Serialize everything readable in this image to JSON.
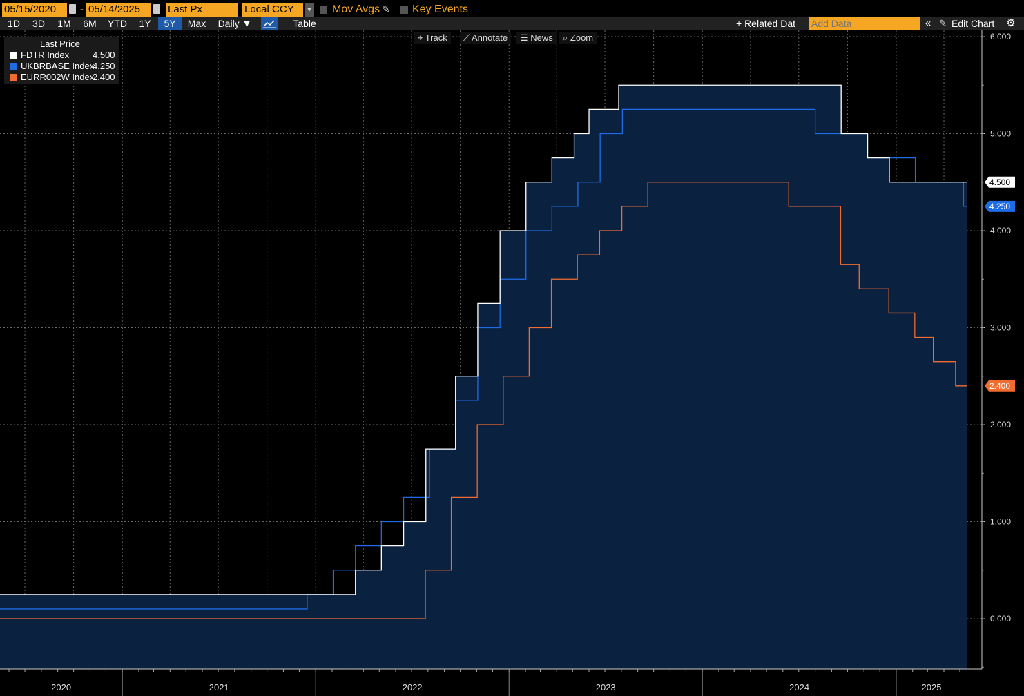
{
  "header": {
    "start_date": "05/15/2020",
    "separator": "-",
    "end_date": "05/14/2025",
    "field": "Last Px",
    "currency": "Local CCY",
    "mov_avgs": "Mov Avgs",
    "key_events": "Key Events"
  },
  "periods": [
    "1D",
    "3D",
    "1M",
    "6M",
    "YTD",
    "1Y",
    "5Y",
    "Max"
  ],
  "active_period": "5Y",
  "frequency": "Daily ▼",
  "table_label": "Table",
  "related_label": "+ Related Dat",
  "add_data_placeholder": "Add Data",
  "edit_chart_label": "Edit Chart",
  "toolbar": {
    "track": "Track",
    "annotate": "Annotate",
    "news": "News",
    "zoom": "Zoom"
  },
  "legend": {
    "title": "Last Price",
    "items": [
      {
        "name": "FDTR Index",
        "value": "4.500",
        "color": "#ffffff"
      },
      {
        "name": "UKBRBASE Index",
        "value": "4.250",
        "color": "#1e6be6"
      },
      {
        "name": "EURR002W Index",
        "value": "2.400",
        "color": "#f26b2f"
      }
    ]
  },
  "colors": {
    "background": "#000000",
    "area_fill": "#0b2140",
    "grid": "#6a6a6a",
    "accent": "#f5a623"
  },
  "chart_data": {
    "type": "line",
    "xlim": [
      "2020-05-15",
      "2025-05-14"
    ],
    "ylim": [
      -0.5,
      6.0
    ],
    "yticks": [
      "0.000",
      "1.000",
      "2.000",
      "3.000",
      "4.000",
      "5.000",
      "6.000"
    ],
    "xticks": [
      "2020",
      "2021",
      "2022",
      "2023",
      "2024",
      "2025"
    ],
    "series": [
      {
        "name": "FDTR Index",
        "color": "#ffffff",
        "fill": true,
        "last": "4.500",
        "points": [
          [
            "2020-05-15",
            0.25
          ],
          [
            "2022-03-17",
            0.5
          ],
          [
            "2022-05-05",
            0.75
          ],
          [
            "2022-06-16",
            1.0
          ],
          [
            "2022-07-28",
            1.75
          ],
          [
            "2022-09-22",
            2.5
          ],
          [
            "2022-11-03",
            3.25
          ],
          [
            "2022-12-15",
            4.0
          ],
          [
            "2023-02-02",
            4.5
          ],
          [
            "2023-03-23",
            4.75
          ],
          [
            "2023-05-04",
            5.0
          ],
          [
            "2023-06-01",
            5.25
          ],
          [
            "2023-07-27",
            5.5
          ],
          [
            "2024-09-19",
            5.0
          ],
          [
            "2024-11-08",
            4.75
          ],
          [
            "2024-12-19",
            4.5
          ],
          [
            "2025-05-14",
            4.5
          ]
        ]
      },
      {
        "name": "UKBRBASE Index",
        "color": "#1e6be6",
        "last": "4.250",
        "points": [
          [
            "2020-05-15",
            0.1
          ],
          [
            "2021-12-16",
            0.25
          ],
          [
            "2022-02-03",
            0.5
          ],
          [
            "2022-03-17",
            0.75
          ],
          [
            "2022-05-05",
            1.0
          ],
          [
            "2022-06-16",
            1.25
          ],
          [
            "2022-08-04",
            1.75
          ],
          [
            "2022-09-22",
            2.25
          ],
          [
            "2022-11-03",
            3.0
          ],
          [
            "2022-12-15",
            3.5
          ],
          [
            "2023-02-02",
            4.0
          ],
          [
            "2023-03-23",
            4.25
          ],
          [
            "2023-05-11",
            4.5
          ],
          [
            "2023-06-22",
            5.0
          ],
          [
            "2023-08-03",
            5.25
          ],
          [
            "2024-08-01",
            5.0
          ],
          [
            "2024-11-07",
            4.75
          ],
          [
            "2025-02-06",
            4.5
          ],
          [
            "2025-05-08",
            4.25
          ],
          [
            "2025-05-14",
            4.25
          ]
        ]
      },
      {
        "name": "EURR002W Index",
        "color": "#f26b2f",
        "last": "2.400",
        "points": [
          [
            "2020-05-15",
            0.0
          ],
          [
            "2022-07-27",
            0.5
          ],
          [
            "2022-09-14",
            1.25
          ],
          [
            "2022-11-02",
            2.0
          ],
          [
            "2022-12-21",
            2.5
          ],
          [
            "2023-02-08",
            3.0
          ],
          [
            "2023-03-22",
            3.5
          ],
          [
            "2023-05-10",
            3.75
          ],
          [
            "2023-06-21",
            4.0
          ],
          [
            "2023-08-02",
            4.25
          ],
          [
            "2023-09-20",
            4.5
          ],
          [
            "2024-06-12",
            4.25
          ],
          [
            "2024-09-18",
            3.65
          ],
          [
            "2024-10-23",
            3.4
          ],
          [
            "2024-12-18",
            3.15
          ],
          [
            "2025-02-05",
            2.9
          ],
          [
            "2025-03-12",
            2.65
          ],
          [
            "2025-04-23",
            2.4
          ],
          [
            "2025-05-14",
            2.4
          ]
        ]
      }
    ]
  }
}
